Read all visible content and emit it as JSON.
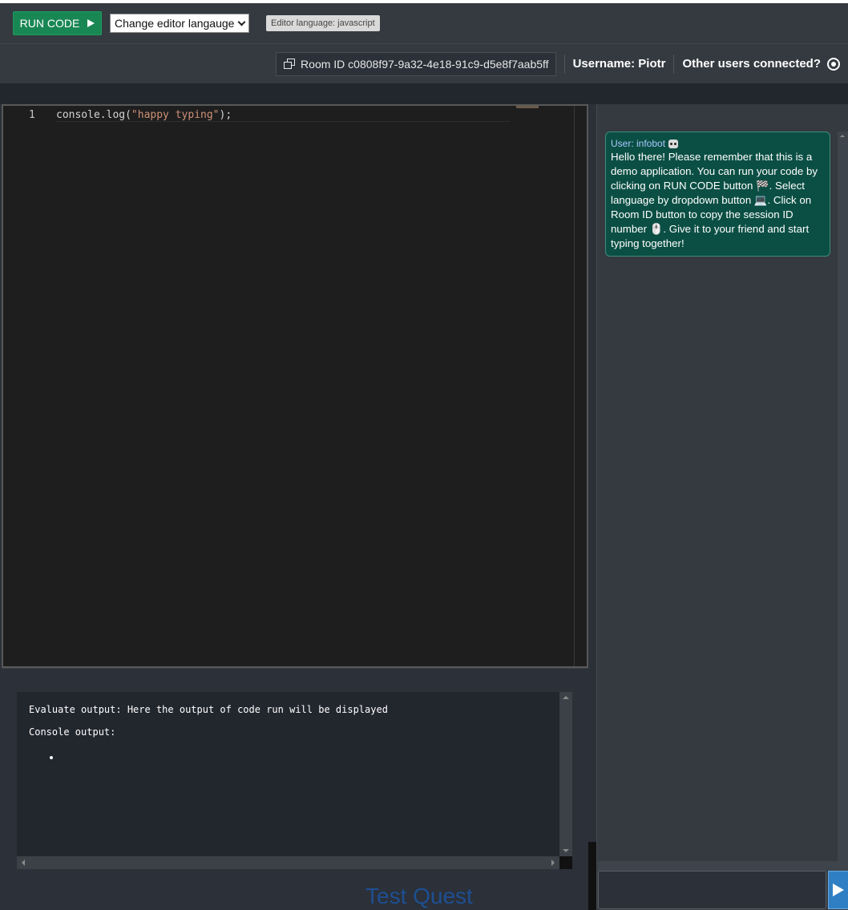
{
  "toolbar": {
    "run_label": "RUN CODE",
    "language_select": "Change editor langauge",
    "language_badge": "Editor language: javascript"
  },
  "header": {
    "room_label": "Room ID c0808f97-9a32-4e18-91c9-d5e8f7aab5ff",
    "username": "Username: Piotr",
    "others_label": "Other users connected?"
  },
  "editor": {
    "line_number": "1",
    "code_prefix": "console.log(",
    "code_string": "\"happy typing\"",
    "code_suffix": ");"
  },
  "output": {
    "evaluate": "Evaluate output: Here the output of code run will be displayed",
    "console": "Console output:"
  },
  "chat": {
    "messages": [
      {
        "user": "User: infobot",
        "text": "Hello there! Please remember that this is a demo application. You can run your code by clicking on RUN CODE button 🏁. Select language by dropdown button 💻. Click on Room ID button to copy the session ID number 🖱️. Give it to your friend and start typing together!"
      }
    ]
  },
  "footer": {
    "brand": "Test Quest"
  },
  "icons": {
    "run": "play-icon",
    "select": "chevron-down-icon",
    "room": "copy-icon",
    "others": "radio-icon",
    "bot": "robot-icon",
    "send": "send-icon"
  },
  "colors": {
    "run_button": "#198754",
    "chat_bubble": "#0b4f44",
    "send_button": "#2f7fc4",
    "brand": "#1e4f91"
  }
}
